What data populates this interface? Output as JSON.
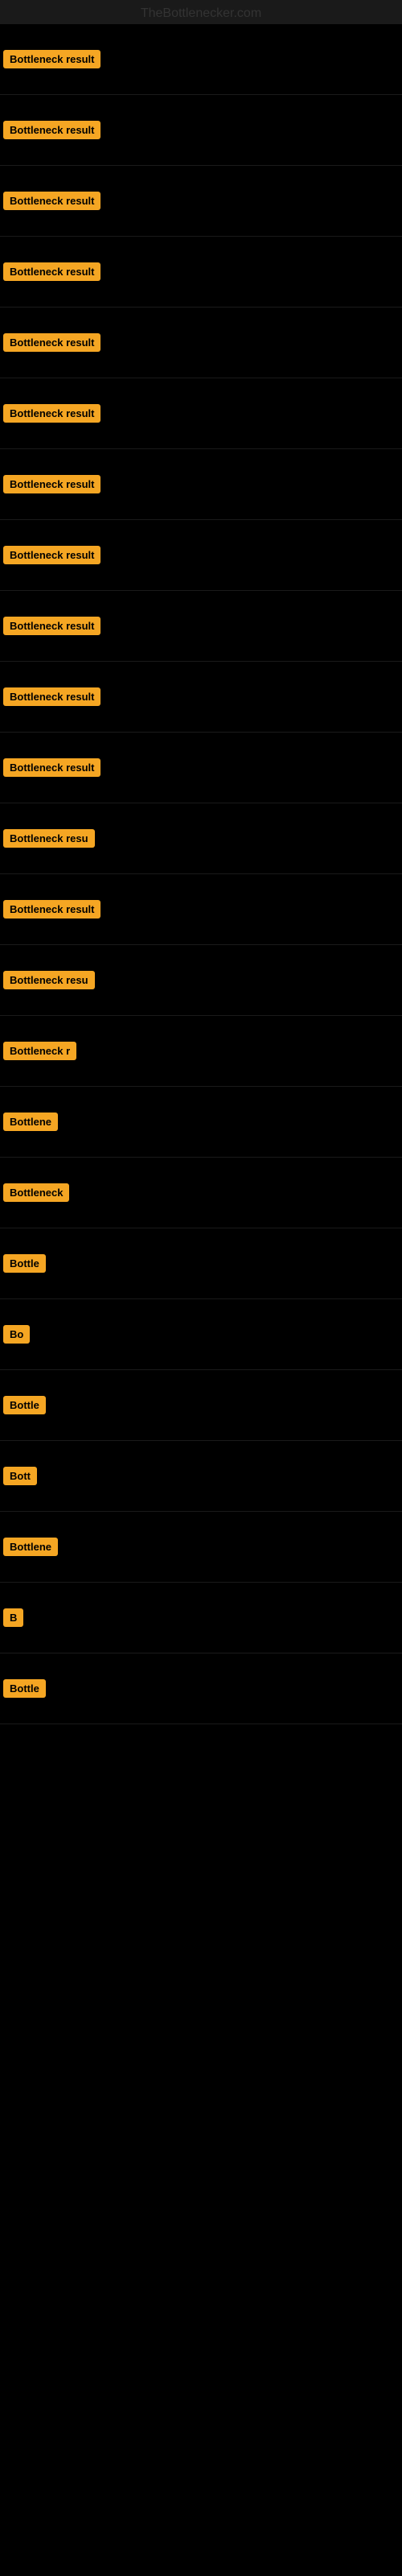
{
  "site": {
    "title": "TheBottlenecker.com"
  },
  "rows": [
    {
      "id": 1,
      "label": "Bottleneck result",
      "visible_text": "Bottleneck result"
    },
    {
      "id": 2,
      "label": "Bottleneck result",
      "visible_text": "Bottleneck result"
    },
    {
      "id": 3,
      "label": "Bottleneck result",
      "visible_text": "Bottleneck result"
    },
    {
      "id": 4,
      "label": "Bottleneck result",
      "visible_text": "Bottleneck result"
    },
    {
      "id": 5,
      "label": "Bottleneck result",
      "visible_text": "Bottleneck result"
    },
    {
      "id": 6,
      "label": "Bottleneck result",
      "visible_text": "Bottleneck result"
    },
    {
      "id": 7,
      "label": "Bottleneck result",
      "visible_text": "Bottleneck result"
    },
    {
      "id": 8,
      "label": "Bottleneck result",
      "visible_text": "Bottleneck result"
    },
    {
      "id": 9,
      "label": "Bottleneck result",
      "visible_text": "Bottleneck result"
    },
    {
      "id": 10,
      "label": "Bottleneck result",
      "visible_text": "Bottleneck result"
    },
    {
      "id": 11,
      "label": "Bottleneck result",
      "visible_text": "Bottleneck result"
    },
    {
      "id": 12,
      "label": "Bottleneck resu",
      "visible_text": "Bottleneck resu"
    },
    {
      "id": 13,
      "label": "Bottleneck result",
      "visible_text": "Bottleneck result"
    },
    {
      "id": 14,
      "label": "Bottleneck resu",
      "visible_text": "Bottleneck resu"
    },
    {
      "id": 15,
      "label": "Bottleneck r",
      "visible_text": "Bottleneck r"
    },
    {
      "id": 16,
      "label": "Bottlene",
      "visible_text": "Bottlene"
    },
    {
      "id": 17,
      "label": "Bottleneck",
      "visible_text": "Bottleneck"
    },
    {
      "id": 18,
      "label": "Bottle",
      "visible_text": "Bottle"
    },
    {
      "id": 19,
      "label": "Bo",
      "visible_text": "Bo"
    },
    {
      "id": 20,
      "label": "Bottle",
      "visible_text": "Bottle"
    },
    {
      "id": 21,
      "label": "Bott",
      "visible_text": "Bott"
    },
    {
      "id": 22,
      "label": "Bottlene",
      "visible_text": "Bottlene"
    },
    {
      "id": 23,
      "label": "B",
      "visible_text": "B"
    },
    {
      "id": 24,
      "label": "Bottle",
      "visible_text": "Bottle"
    }
  ]
}
